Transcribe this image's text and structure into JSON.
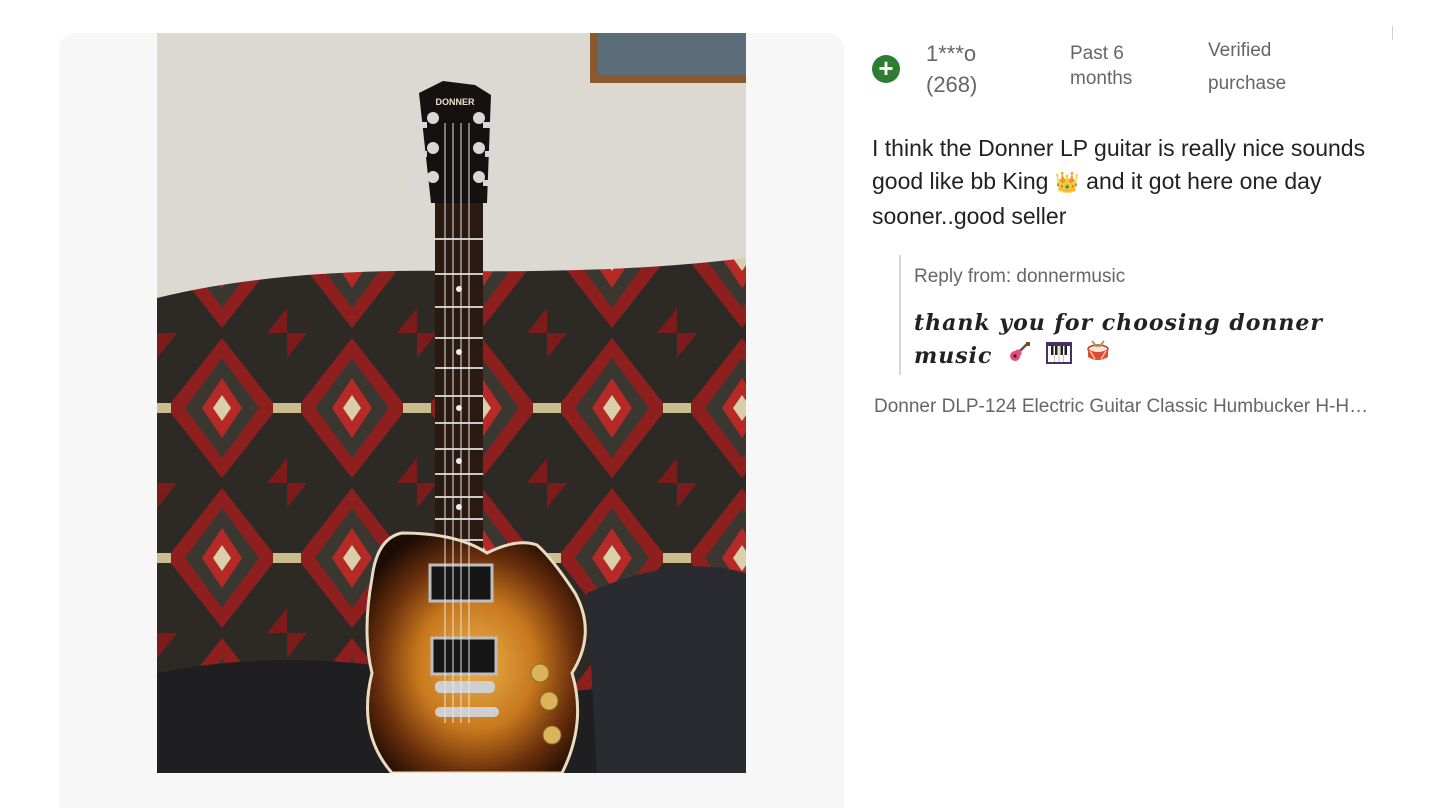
{
  "review": {
    "user_name": "1***o",
    "user_count": "(268)",
    "time_line1": "Past 6",
    "time_line2": "months",
    "verified_line1": "Verified",
    "verified_line2": "purchase",
    "text_part1": "I think the Donner LP guitar is really nice sounds good like bb King ",
    "text_part2": " and it got here one day sooner..good seller",
    "crown_emoji": "👑"
  },
  "reply": {
    "from_label": "Reply from: donnermusic",
    "text": "thank you for choosing donner music"
  },
  "product": {
    "name": "Donner DLP-124 Electric Guitar Classic Humbucker H-H…"
  },
  "photo": {
    "headstock_logo": "DONNER"
  },
  "icons": {
    "plus": "plus-circle-icon",
    "guitar": "guitar-emoji-icon",
    "piano": "piano-emoji-icon",
    "drum": "drum-emoji-icon"
  },
  "colors": {
    "accent_green": "#2e7d32",
    "muted_text": "#666666"
  }
}
